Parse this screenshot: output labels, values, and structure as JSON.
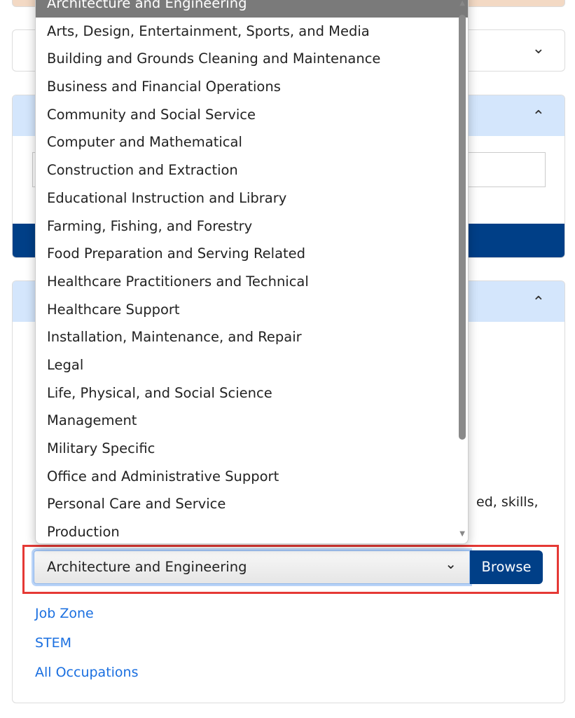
{
  "dropdown": {
    "options": [
      "Architecture and Engineering",
      "Arts, Design, Entertainment, Sports, and Media",
      "Building and Grounds Cleaning and Maintenance",
      "Business and Financial Operations",
      "Community and Social Service",
      "Computer and Mathematical",
      "Construction and Extraction",
      "Educational Instruction and Library",
      "Farming, Fishing, and Forestry",
      "Food Preparation and Serving Related",
      "Healthcare Practitioners and Technical",
      "Healthcare Support",
      "Installation, Maintenance, and Repair",
      "Legal",
      "Life, Physical, and Social Science",
      "Management",
      "Military Specific",
      "Office and Administrative Support",
      "Personal Care and Service",
      "Production"
    ],
    "selected_index": 0
  },
  "browse": {
    "select_value": "Architecture and Engineering",
    "button_label": "Browse",
    "partial_text": "ed, skills,"
  },
  "links": [
    "Job Zone",
    "STEM",
    "All Occupations"
  ],
  "colors": {
    "accent": "#003f87",
    "header": "#d4e6fc",
    "link": "#1a6fe0",
    "highlight": "#e53935"
  }
}
